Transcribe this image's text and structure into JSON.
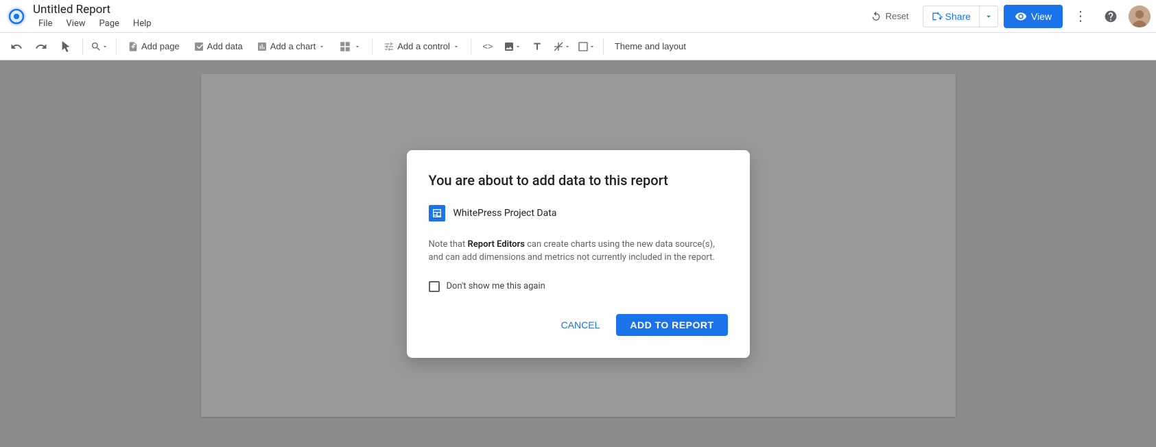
{
  "titlebar": {
    "app_title": "Untitled Report",
    "menu_items": [
      "File",
      "View",
      "Page",
      "Help"
    ],
    "reset_label": "Reset",
    "share_label": "Share",
    "view_label": "View",
    "more_label": "⋮",
    "help_label": "?"
  },
  "toolbar": {
    "undo_label": "↩",
    "redo_label": "↪",
    "cursor_label": "↖",
    "zoom_label": "🔍",
    "add_page_label": "Add page",
    "add_data_label": "Add data",
    "add_chart_label": "Add a chart",
    "community_label": "⊞",
    "add_control_label": "Add a control",
    "embed_label": "<>",
    "image_label": "🖼",
    "text_label": "T",
    "line_label": "╲",
    "shape_label": "□",
    "theme_label": "Theme and layout"
  },
  "modal": {
    "title": "You are about to add data to this report",
    "data_source_name": "WhitePress Project Data",
    "note_text_before": "Note that ",
    "note_bold": "Report Editors",
    "note_text_after": " can create charts using the new data source(s), and can add dimensions and metrics not currently included in the report.",
    "checkbox_label": "Don't show me this again",
    "cancel_label": "CANCEL",
    "add_label": "ADD TO REPORT"
  },
  "colors": {
    "accent": "#1a73e8",
    "text_primary": "#202124",
    "text_secondary": "#5f6368"
  }
}
